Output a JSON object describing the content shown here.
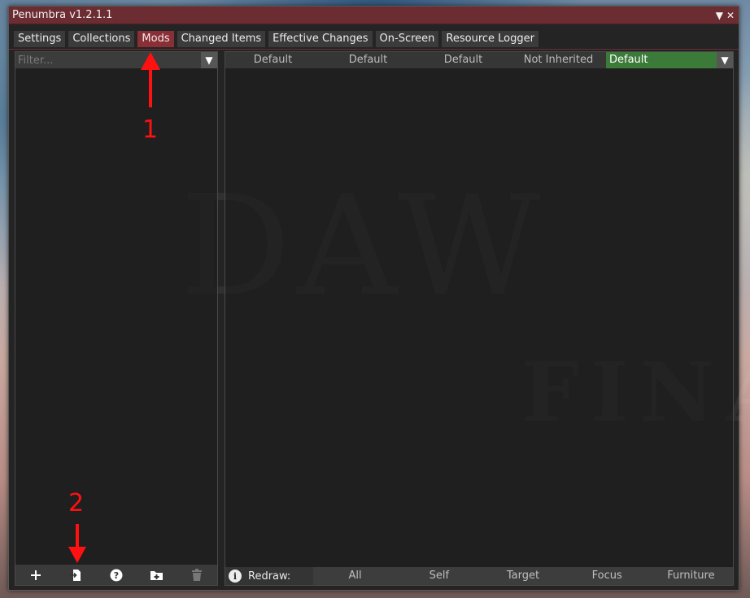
{
  "window": {
    "title": "Penumbra v1.2.1.1",
    "collapse_glyph": "▼",
    "close_glyph": "✕"
  },
  "tabs": [
    {
      "label": "Settings",
      "active": false
    },
    {
      "label": "Collections",
      "active": false
    },
    {
      "label": "Mods",
      "active": true
    },
    {
      "label": "Changed Items",
      "active": false
    },
    {
      "label": "Effective Changes",
      "active": false
    },
    {
      "label": "On-Screen",
      "active": false
    },
    {
      "label": "Resource Logger",
      "active": false
    }
  ],
  "mod_list": {
    "filter_placeholder": "Filter...",
    "filter_value": "",
    "footer_icons": [
      "plus-icon",
      "import-file-icon",
      "help-icon",
      "new-folder-icon",
      "trash-icon"
    ]
  },
  "collections": {
    "items": [
      "Default",
      "Default",
      "Default",
      "Not Inherited"
    ],
    "selected": "Default"
  },
  "redraw": {
    "label": "Redraw:",
    "buttons": [
      "All",
      "Self",
      "Target",
      "Focus",
      "Furniture"
    ]
  },
  "annotations": [
    {
      "number": "1",
      "color": "#ff1111"
    },
    {
      "number": "2",
      "color": "#ff1111"
    }
  ],
  "background_text": {
    "line1": "DAW",
    "line2": "FINAL"
  },
  "colors": {
    "titlebar": "#6b2c32",
    "active_tab": "#8a2f36",
    "selected_collection": "#3c7a3a",
    "panel_bg": "#242424"
  }
}
